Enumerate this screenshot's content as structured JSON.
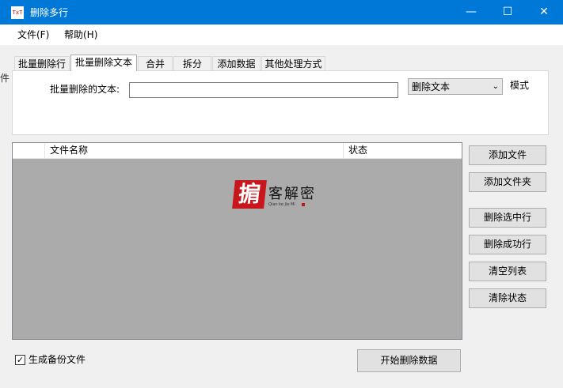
{
  "window": {
    "title": "删除多行",
    "icon_text": "TxT",
    "minimize_icon": "—",
    "maximize_icon": "☐",
    "close_icon": "✕"
  },
  "menu": [
    "文件(F)",
    "帮助(H)"
  ],
  "edge_text": "件",
  "tabs": [
    "批量删除行",
    "批量删除文本",
    "合并",
    "拆分",
    "添加数据",
    "其他处理方式"
  ],
  "active_tab_index": 1,
  "panel": {
    "label": "批量删除的文本:",
    "input_value": "",
    "select_value": "删除文本",
    "select_arrow": "⌄",
    "mode_label": "模式"
  },
  "file_list": {
    "columns": [
      "",
      "文件名称",
      "状态"
    ],
    "rows": []
  },
  "watermark": {
    "mark": "掮",
    "text": "客解密",
    "sub": "Qian ke Jie Mi"
  },
  "side_buttons": [
    "添加文件",
    "添加文件夹",
    "删除选中行",
    "删除成功行",
    "清空列表",
    "清除状态"
  ],
  "backup": {
    "checked": true,
    "check_glyph": "✓",
    "label": "生成备份文件"
  },
  "start_button": "开始删除数据",
  "colors": {
    "titlebar": "#0078d7",
    "list_bg": "#ababab",
    "logo_red": "#c8161d"
  }
}
